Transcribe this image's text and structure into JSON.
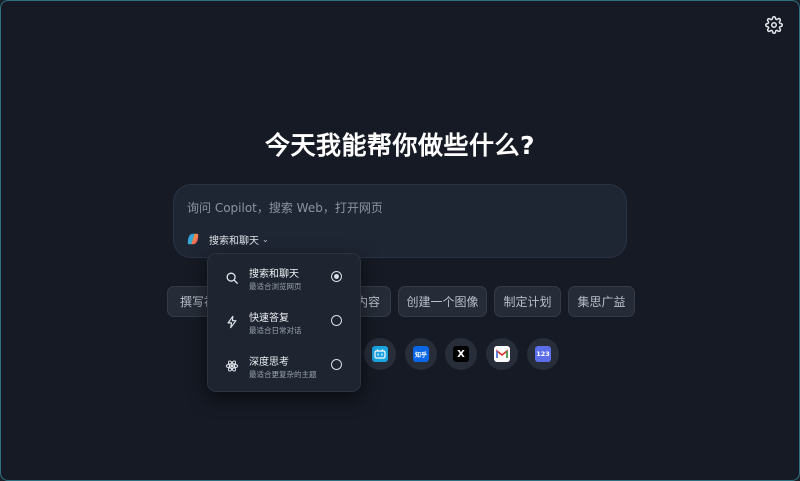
{
  "settings": {
    "icon": "gear-icon"
  },
  "headline": "今天我能帮你做些什么?",
  "composer": {
    "placeholder": "询问 Copilot，搜索 Web，打开网页",
    "value": "",
    "logo_icon": "copilot-icon",
    "mode_label": "搜索和聊天"
  },
  "chips": [
    {
      "label": "撰写初"
    },
    {
      "label": "内容"
    },
    {
      "label": "创建一个图像"
    },
    {
      "label": "制定计划"
    },
    {
      "label": "集思广益"
    }
  ],
  "sites": [
    {
      "name": "bilibili",
      "icon": "bilibili-icon",
      "glyph": "",
      "color": "#1aa4e0"
    },
    {
      "name": "zhihu",
      "icon": "zhihu-icon",
      "glyph": "知乎",
      "color": "#0a66e4"
    },
    {
      "name": "x",
      "icon": "x-icon",
      "glyph": "X",
      "color": "#000000"
    },
    {
      "name": "gmail",
      "icon": "gmail-icon",
      "glyph": "M",
      "color": "#ffffff"
    },
    {
      "name": "calculator",
      "icon": "calculator-icon",
      "glyph": "123",
      "color": "#5b6de8"
    }
  ],
  "mode_menu": {
    "options": [
      {
        "title": "搜索和聊天",
        "subtitle": "最适合浏览网页",
        "icon": "search-icon",
        "selected": true
      },
      {
        "title": "快速答复",
        "subtitle": "最适合日常对话",
        "icon": "lightning-icon",
        "selected": false
      },
      {
        "title": "深度思考",
        "subtitle": "最适合更复杂的主题",
        "icon": "atom-icon",
        "selected": false
      }
    ]
  }
}
